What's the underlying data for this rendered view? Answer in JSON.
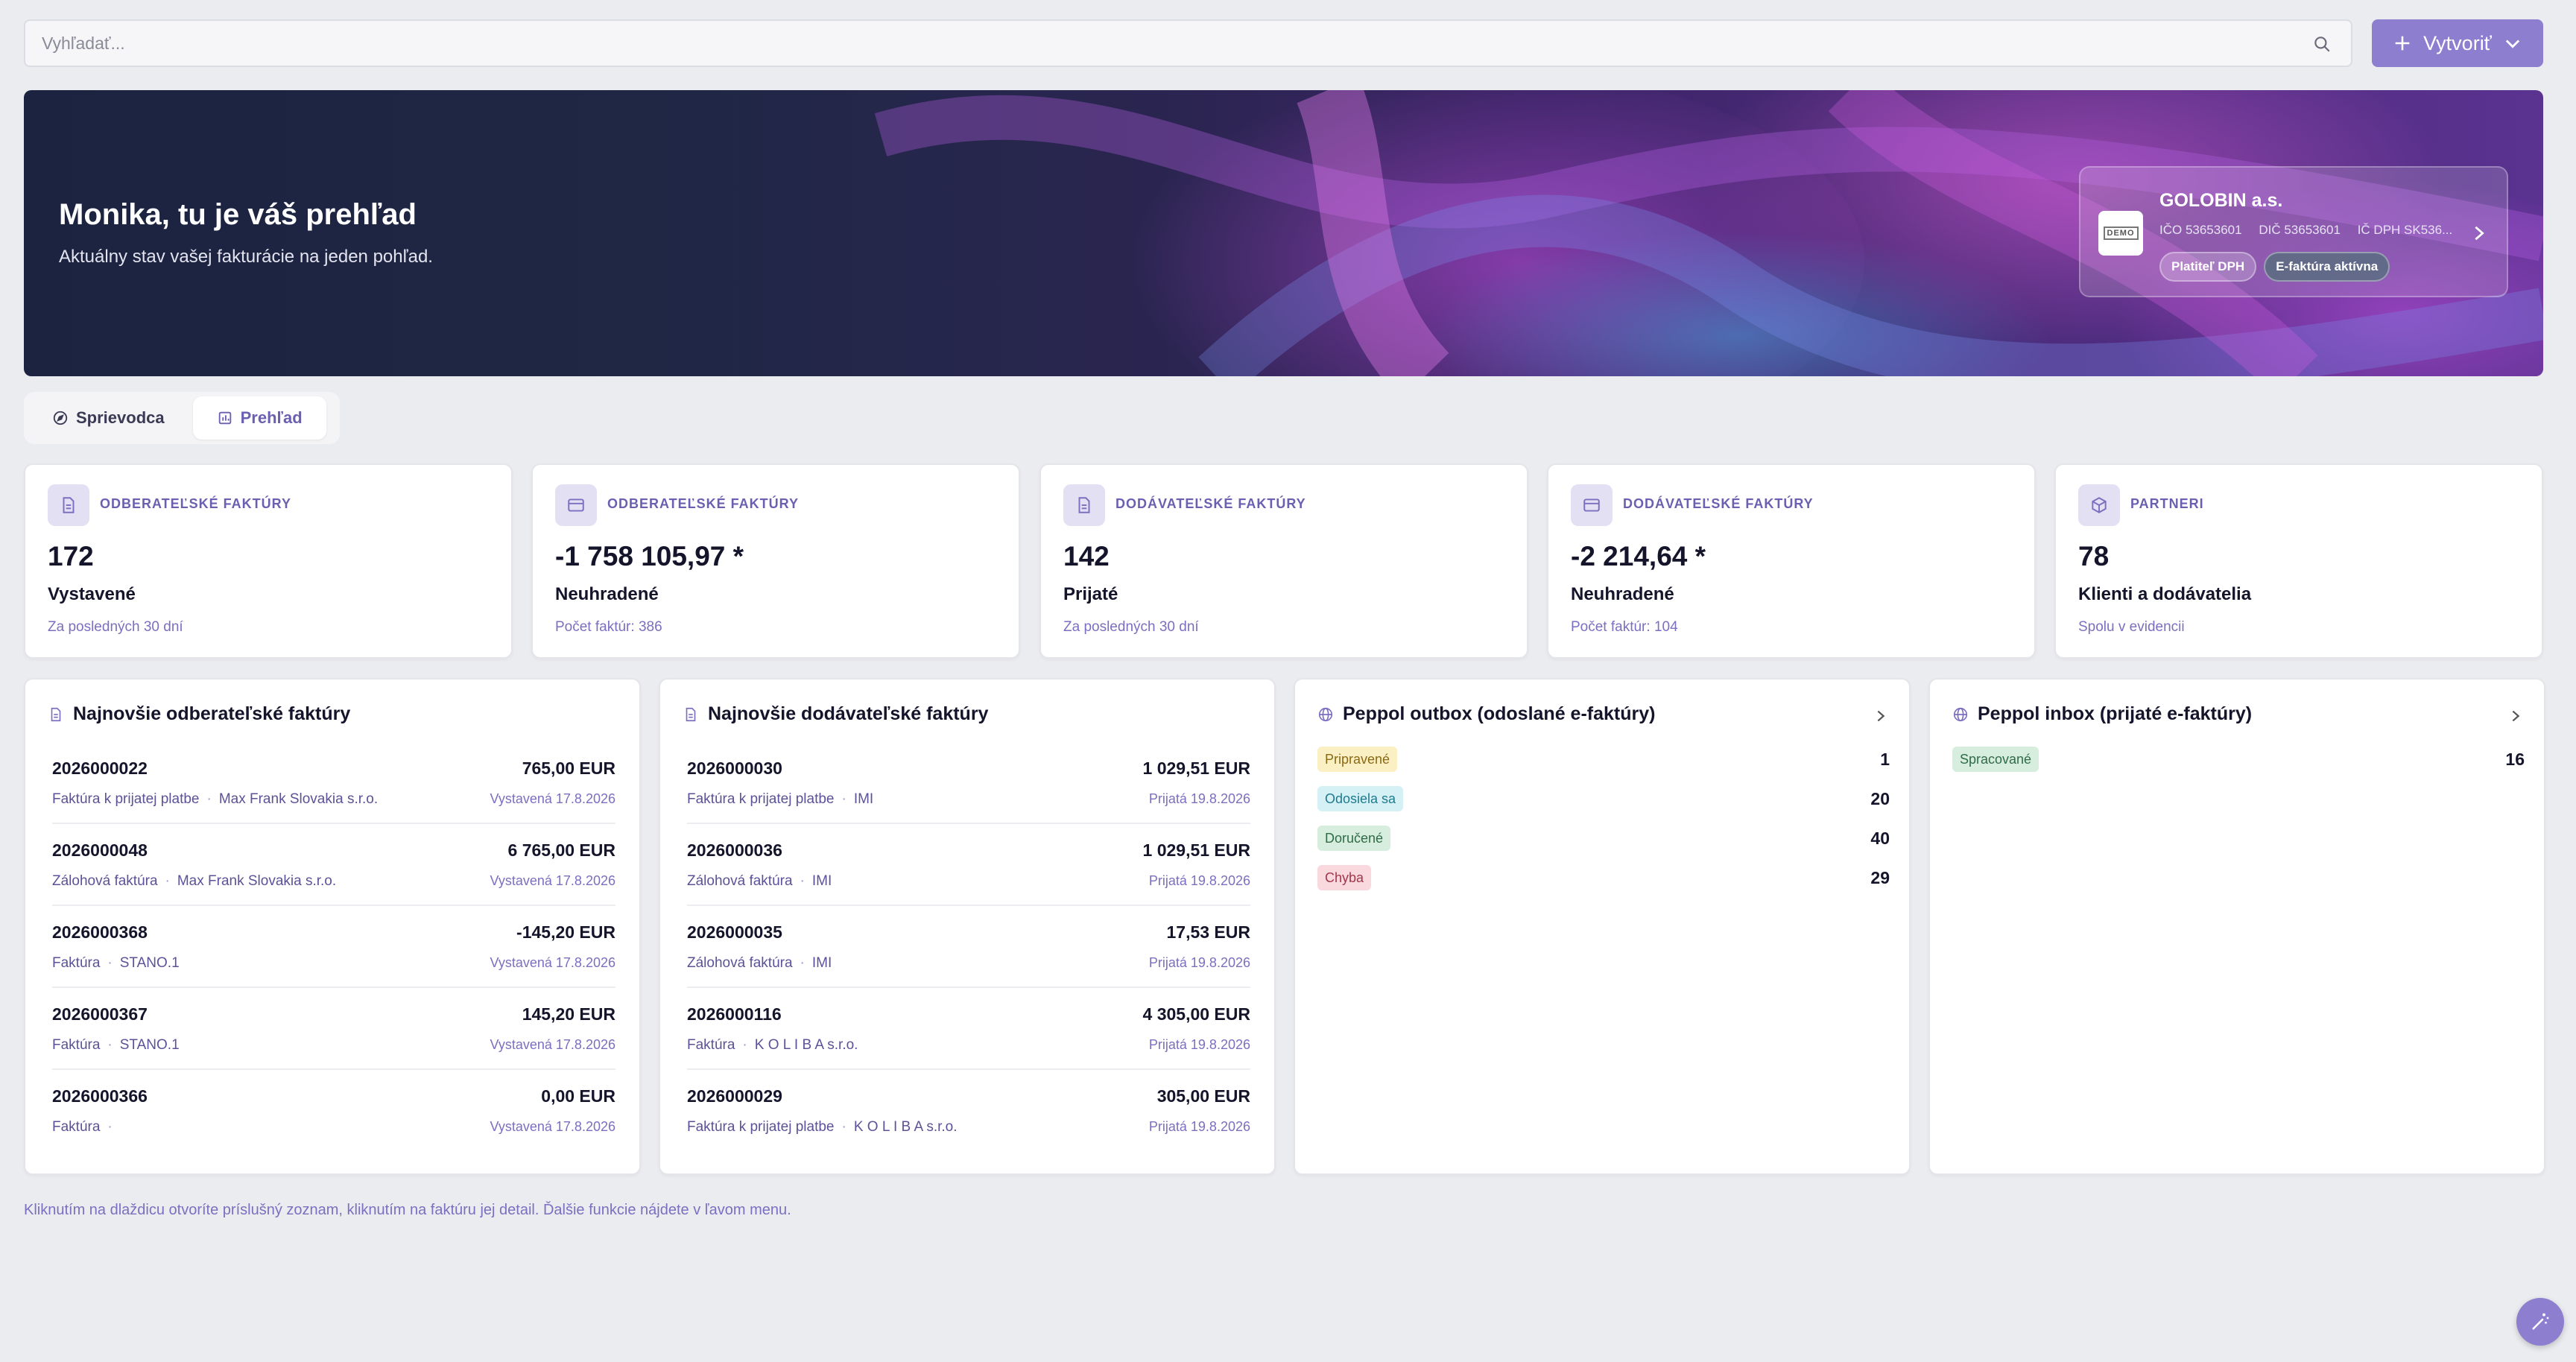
{
  "search": {
    "placeholder": "Vyhľadať..."
  },
  "create_button": {
    "label": "Vytvoriť"
  },
  "hero": {
    "title": "Monika, tu je váš prehľad",
    "subtitle": "Aktuálny stav vašej fakturácie na jeden pohľad.",
    "company": {
      "logo_text": "DEMO",
      "name": "GOLOBIN a.s.",
      "ico": "IČO 53653601",
      "dic": "DIČ 53653601",
      "icdph": "IČ DPH SK536...",
      "badges": [
        "Platiteľ DPH",
        "E-faktúra aktívna"
      ]
    }
  },
  "tabs": [
    {
      "label": "Sprievodca"
    },
    {
      "label": "Prehľad",
      "active": true
    }
  ],
  "stats": [
    {
      "label": "Odberateľské faktúry",
      "value": "172",
      "caption": "Vystavené",
      "note": "Za posledných 30 dní",
      "icon": "document-icon"
    },
    {
      "label": "Odberateľské faktúry",
      "value": "-1 758 105,97 *",
      "caption": "Neuhradené",
      "note": "Počet faktúr: 386",
      "icon": "credit-card-icon"
    },
    {
      "label": "Dodávateľské faktúry",
      "value": "142",
      "caption": "Prijaté",
      "note": "Za posledných 30 dní",
      "icon": "document-icon"
    },
    {
      "label": "Dodávateľské faktúry",
      "value": "-2 214,64 *",
      "caption": "Neuhradené",
      "note": "Počet faktúr: 104",
      "icon": "credit-card-icon"
    },
    {
      "label": "Partneri",
      "value": "78",
      "caption": "Klienti a dodávatelia",
      "note": "Spolu v evidencii",
      "icon": "cube-icon"
    }
  ],
  "customer_invoices": {
    "title": "Najnovšie odberateľské faktúry",
    "items": [
      {
        "number": "2026000022",
        "amount": "765,00 EUR",
        "type": "Faktúra k prijatej platbe",
        "partner": "Max Frank Slovakia s.r.o.",
        "date": "Vystavená 17.8.2026"
      },
      {
        "number": "2026000048",
        "amount": "6 765,00 EUR",
        "type": "Zálohová faktúra",
        "partner": "Max Frank Slovakia s.r.o.",
        "date": "Vystavená 17.8.2026"
      },
      {
        "number": "2026000368",
        "amount": "-145,20 EUR",
        "type": "Faktúra",
        "partner": "STANO.1",
        "date": "Vystavená 17.8.2026"
      },
      {
        "number": "2026000367",
        "amount": "145,20 EUR",
        "type": "Faktúra",
        "partner": "STANO.1",
        "date": "Vystavená 17.8.2026"
      },
      {
        "number": "2026000366",
        "amount": "0,00 EUR",
        "type": "Faktúra",
        "partner": "",
        "date": "Vystavená 17.8.2026"
      }
    ]
  },
  "supplier_invoices": {
    "title": "Najnovšie dodávateľské faktúry",
    "items": [
      {
        "number": "2026000030",
        "amount": "1 029,51 EUR",
        "type": "Faktúra k prijatej platbe",
        "partner": "IMI",
        "date": "Prijatá 19.8.2026"
      },
      {
        "number": "2026000036",
        "amount": "1 029,51 EUR",
        "type": "Zálohová faktúra",
        "partner": "IMI",
        "date": "Prijatá 19.8.2026"
      },
      {
        "number": "2026000035",
        "amount": "17,53 EUR",
        "type": "Zálohová faktúra",
        "partner": "IMI",
        "date": "Prijatá 19.8.2026"
      },
      {
        "number": "2026000116",
        "amount": "4 305,00 EUR",
        "type": "Faktúra",
        "partner": "K O L I B A s.r.o.",
        "date": "Prijatá 19.8.2026"
      },
      {
        "number": "2026000029",
        "amount": "305,00 EUR",
        "type": "Faktúra k prijatej platbe",
        "partner": "K O L I B A s.r.o.",
        "date": "Prijatá 19.8.2026"
      }
    ]
  },
  "peppol_outbox": {
    "title": "Peppol outbox (odoslané e-faktúry)",
    "rows": [
      {
        "status": "Pripravené",
        "count": "1",
        "bg": "#fbefc4",
        "fg": "#8a6a12"
      },
      {
        "status": "Odosiela sa",
        "count": "20",
        "bg": "#d5f1f6",
        "fg": "#1e7a8c"
      },
      {
        "status": "Doručené",
        "count": "40",
        "bg": "#d7eedf",
        "fg": "#2f6b47"
      },
      {
        "status": "Chyba",
        "count": "29",
        "bg": "#f9d9de",
        "fg": "#a2364a"
      }
    ]
  },
  "peppol_inbox": {
    "title": "Peppol inbox (prijaté e-faktúry)",
    "rows": [
      {
        "status": "Spracované",
        "count": "16",
        "bg": "#d7eedf",
        "fg": "#2f6b47"
      }
    ]
  },
  "footer": {
    "note": "Kliknutím na dlaždicu otvoríte príslušný zoznam, kliknutím na faktúru jej detail. Ďalšie funkcie nájdete v ľavom menu."
  },
  "colors": {
    "accent": "#8d7ed0",
    "accent_text": "#6a5fb0",
    "background": "#ebecf0"
  }
}
